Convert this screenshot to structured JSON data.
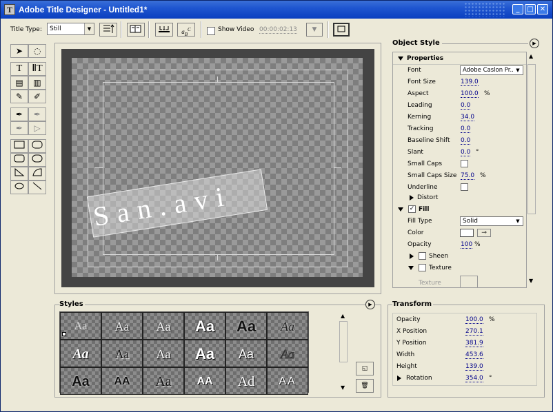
{
  "window": {
    "title": "Adobe Title Designer - Untitled1*",
    "minimize_glyph": "_",
    "maximize_glyph": "□",
    "close_glyph": "✕"
  },
  "toolbar": {
    "title_type_label": "Title Type:",
    "title_type_value": "Still",
    "show_video_label": "Show Video",
    "show_video_checked": false,
    "timecode": "00:00:02:13"
  },
  "canvas": {
    "sample_text": "San.avi"
  },
  "object_style": {
    "header": "Object Style",
    "properties_label": "Properties",
    "rows": [
      {
        "name": "Font",
        "value": "Adobe Caslon Pr...",
        "kind": "select"
      },
      {
        "name": "Font Size",
        "value": "139.0",
        "unit": ""
      },
      {
        "name": "Aspect",
        "value": "100.0",
        "unit": "%"
      },
      {
        "name": "Leading",
        "value": "0.0",
        "unit": ""
      },
      {
        "name": "Kerning",
        "value": "34.0",
        "unit": ""
      },
      {
        "name": "Tracking",
        "value": "0.0",
        "unit": ""
      },
      {
        "name": "Baseline Shift",
        "value": "0.0",
        "unit": ""
      },
      {
        "name": "Slant",
        "value": "0.0",
        "unit": "°"
      },
      {
        "name": "Small Caps",
        "value": "",
        "kind": "checkbox"
      },
      {
        "name": "Small Caps Size",
        "value": "75.0",
        "unit": "%"
      },
      {
        "name": "Underline",
        "value": "",
        "kind": "checkbox"
      }
    ],
    "distort_label": "Distort",
    "fill_label": "Fill",
    "fill_checked": true,
    "fill_type_label": "Fill Type",
    "fill_type_value": "Solid",
    "color_label": "Color",
    "opacity_label": "Opacity",
    "opacity_value": "100",
    "opacity_unit": "%",
    "sheen_label": "Sheen",
    "texture_label": "Texture",
    "texture_sub_label": "Texture"
  },
  "styles": {
    "header": "Styles",
    "sample": "Aa",
    "rows": [
      [
        "Aa",
        "Aa",
        "Aa",
        "Aa",
        "Aa",
        "Aa"
      ],
      [
        "Aa",
        "Aa",
        "Aa",
        "Aa",
        "Aa",
        "Aa"
      ],
      [
        "Aa",
        "AA",
        "Aa",
        "AA",
        "Ad",
        "AA"
      ]
    ]
  },
  "transform": {
    "header": "Transform",
    "rows": [
      {
        "name": "Opacity",
        "value": "100.0",
        "unit": "%"
      },
      {
        "name": "X Position",
        "value": "270.1",
        "unit": ""
      },
      {
        "name": "Y Position",
        "value": "381.9",
        "unit": ""
      },
      {
        "name": "Width",
        "value": "453.6",
        "unit": ""
      },
      {
        "name": "Height",
        "value": "139.0",
        "unit": ""
      },
      {
        "name": "Rotation",
        "value": "354.0",
        "unit": "°"
      }
    ]
  },
  "colors": {
    "titlebar": "#1f56d0",
    "panel_bg": "#ece9d8",
    "value_text": "#00008b",
    "canvas_bg": "#444444"
  }
}
